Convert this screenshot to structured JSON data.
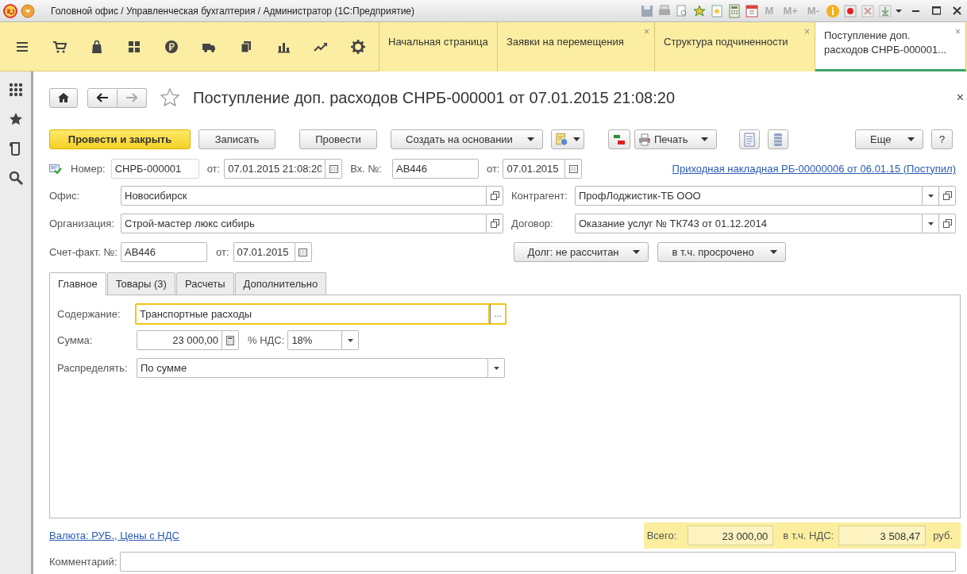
{
  "window": {
    "title": "Головной офис / Управленческая бухгалтерия / Администратор  (1С:Предприятие)",
    "memory_buttons": [
      "M",
      "M+",
      "M-"
    ]
  },
  "sections": [
    {
      "kind": "menu"
    },
    {
      "kind": "cart"
    },
    {
      "kind": "bag"
    },
    {
      "kind": "grid"
    },
    {
      "kind": "coin"
    },
    {
      "kind": "truck"
    },
    {
      "kind": "documents"
    },
    {
      "kind": "bars"
    },
    {
      "kind": "trend"
    },
    {
      "kind": "gear"
    }
  ],
  "tabs": [
    {
      "label": "Начальная страница",
      "selected": false
    },
    {
      "label": "Заявки на перемещения",
      "selected": false,
      "close": "×"
    },
    {
      "label": "Структура подчиненности",
      "selected": false,
      "close": "×"
    },
    {
      "label": "Поступление доп. расходов СНРБ-000001...",
      "selected": true,
      "close": "×"
    }
  ],
  "sidebar": [
    {
      "kind": "apps"
    },
    {
      "kind": "star"
    },
    {
      "kind": "history"
    },
    {
      "kind": "search"
    }
  ],
  "form": {
    "title": "Поступление доп. расходов СНРБ-000001 от 07.01.2015 21:08:20",
    "favorite": false,
    "close": "×"
  },
  "toolbar": [
    {
      "label": "Провести и закрыть",
      "kind": "primary"
    },
    {
      "label": "Записать",
      "kind": "button"
    },
    {
      "label": "Провести",
      "kind": "button"
    },
    {
      "label": "Создать на основании",
      "kind": "dropdown"
    },
    {
      "kind": "report-menu"
    },
    {
      "kind": "dtkt"
    },
    {
      "label": "Печать",
      "kind": "print"
    },
    {
      "kind": "doc-icon"
    },
    {
      "kind": "list-icon"
    },
    {
      "label": "Еще",
      "kind": "dropdown"
    },
    {
      "label": "?",
      "kind": "help"
    }
  ],
  "header": {
    "posted": true,
    "number": {
      "label": "Номер:",
      "value": "СНРБ-000001"
    },
    "date": {
      "label": "от:",
      "value": "07.01.2015 21:08:20"
    },
    "in_number": {
      "label": "Вх. №:",
      "value": "АВ446"
    },
    "in_date": {
      "label": "от:",
      "value": "07.01.2015"
    },
    "base_link": "Приходная накладная РБ-00000006 от 06.01.15 (Поступил)"
  },
  "left_fields": [
    {
      "label": "Офис:",
      "value": "Новосибирск"
    },
    {
      "label": "Организация:",
      "value": "Строй-мастер люкс сибирь"
    }
  ],
  "right_fields": [
    {
      "label": "Контрагент:",
      "value": "ПрофЛоджистик-ТБ ООО"
    },
    {
      "label": "Договор:",
      "value": "Оказание услуг № ТК743 от 01.12.2014"
    }
  ],
  "invoice": {
    "label": "Счет-факт. №:",
    "value": "АВ446",
    "date_label": "от:",
    "date": "07.01.2015"
  },
  "debt_buttons": [
    "Долг: не рассчитан",
    "в т.ч. просрочено"
  ],
  "form_tabs": [
    {
      "label": "Главное",
      "selected": true
    },
    {
      "label": "Товары (3)",
      "selected": false
    },
    {
      "label": "Расчеты",
      "selected": false
    },
    {
      "label": "Дополнительно",
      "selected": false
    }
  ],
  "main": {
    "content": {
      "label": "Содержание:",
      "value": "Транспортные расходы",
      "focused": true,
      "choice": "..."
    },
    "sum": {
      "label": "Сумма:",
      "value": "23 000,00"
    },
    "vat": {
      "label": "% НДС:",
      "value": "18%"
    },
    "distribute": {
      "label": "Распределять:",
      "value": "По сумме"
    }
  },
  "footer": {
    "currency_link": "Валюта: РУБ., Цены с НДС",
    "total_label": "Всего:",
    "total": "23 000,00",
    "vat_label": "в т.ч. НДС:",
    "vat": "3 508,47",
    "currency": "руб."
  },
  "comment": {
    "label": "Комментарий:"
  }
}
